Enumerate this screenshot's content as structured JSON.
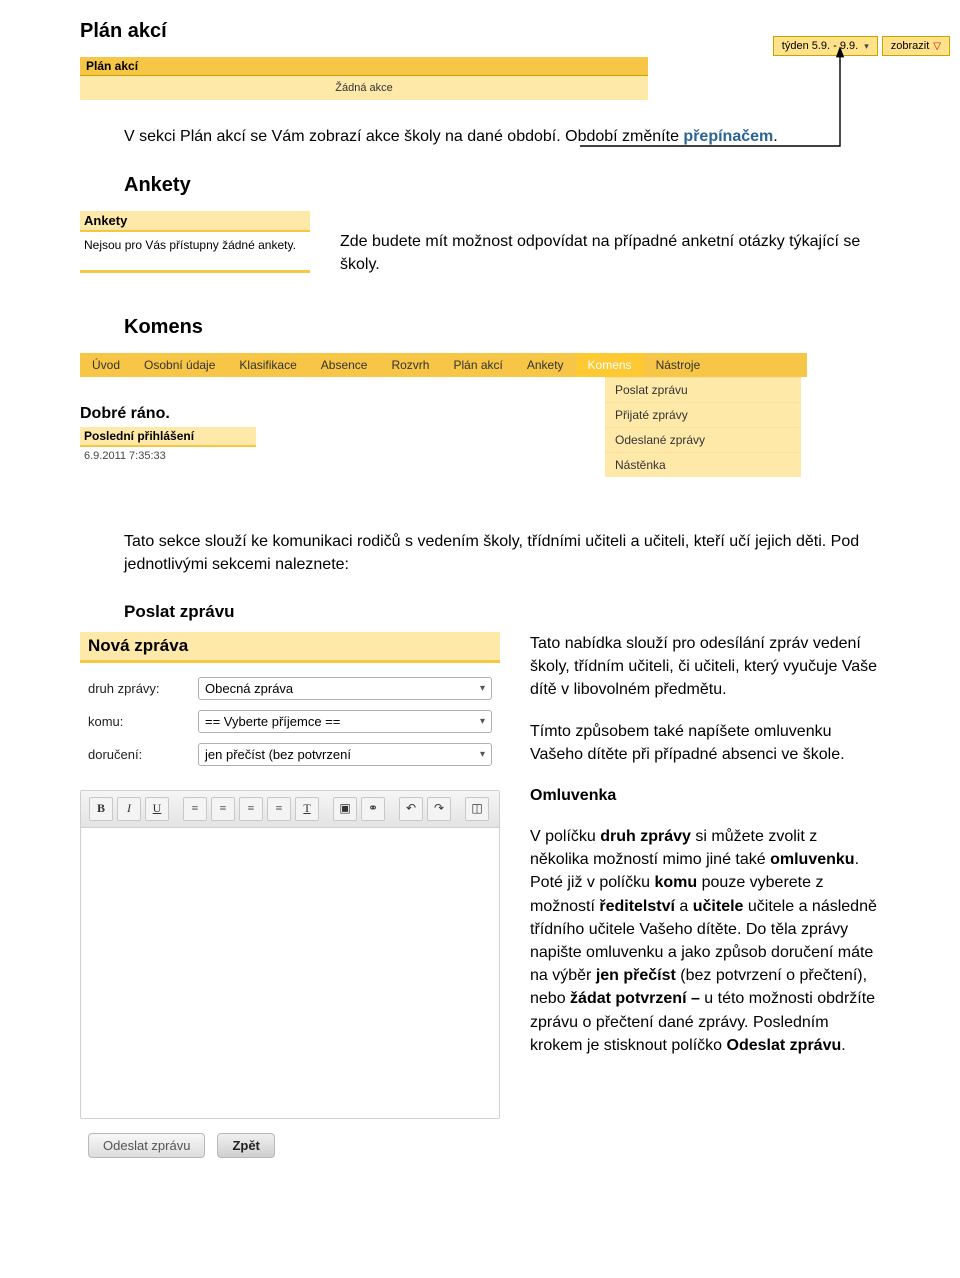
{
  "section_plan": "Plán akcí",
  "switcher": {
    "period": "týden 5.9. - 9.9.",
    "show": "zobrazit"
  },
  "plan_box": {
    "title": "Plán akcí",
    "empty": "Žádná akce"
  },
  "plan_desc": {
    "t1": "V sekci Plán akcí se Vám zobrazí akce školy na dané období. Období změníte ",
    "link": "přepínačem",
    "tail": "."
  },
  "section_ankety": "Ankety",
  "ankety_box": {
    "title": "Ankety",
    "body": "Nejsou pro Vás přístupny žádné ankety."
  },
  "ankety_desc": "Zde budete mít možnost odpovídat na případné anketní otázky týkající se školy.",
  "section_komens": "Komens",
  "nav": [
    "Úvod",
    "Osobní údaje",
    "Klasifikace",
    "Absence",
    "Rozvrh",
    "Plán akcí",
    "Ankety",
    "Komens",
    "Nástroje"
  ],
  "drop": [
    "Poslat zprávu",
    "Přijaté zprávy",
    "Odeslané zprávy",
    "Nástěnka"
  ],
  "greet": "Dobré ráno.",
  "login": {
    "head": "Poslední přihlášení",
    "val": "6.9.2011 7:35:33"
  },
  "komens_desc": "Tato sekce slouží ke komunikaci rodičů s vedením školy, třídními učiteli a učiteli, kteří učí jejich děti. Pod jednotlivými sekcemi naleznete:",
  "section_poslat": "Poslat zprávu",
  "msg": {
    "title": "Nová zpráva",
    "rows": {
      "druh": {
        "lbl": "druh zprávy:",
        "val": "Obecná zpráva"
      },
      "komu": {
        "lbl": "komu:",
        "val": "== Vyberte příjemce =="
      },
      "dor": {
        "lbl": "doručení:",
        "val": "jen přečíst (bez potvrzení"
      }
    },
    "send": "Odeslat zprávu",
    "back": "Zpět"
  },
  "poslat_text": {
    "p1": "Tato nabídka slouží pro odesílání zpráv vedení školy, třídním učiteli, či učiteli, který vyučuje Vaše dítě v libovolném předmětu.",
    "p2": "Tímto způsobem také napíšete omluvenku Vašeho dítěte při případné absenci ve škole.",
    "h": "Omluvenka",
    "p3a": "V políčku ",
    "p3b": "druh zprávy",
    "p3c": " si můžete zvolit z několika možností mimo jiné také ",
    "p3d": "omluvenku",
    "p3e": ". Poté již v políčku ",
    "p3f": "komu",
    "p3g": " pouze vyberete z možností ",
    "p3h": "ředitelství",
    "p3i": " a ",
    "p3j": "učitele",
    "p3k": " učitele a následně třídního učitele Vašeho dítěte. Do těla zprávy napište omluvenku a jako způsob doručení máte na výběr ",
    "p3l": "jen přečíst",
    "p3m": " (bez potvrzení o přečtení), nebo ",
    "p3n": "žádat potvrzení – ",
    "p3o": "u této možnosti obdržíte zprávu o přečtení dané zprávy. Posledním krokem je stisknout políčko ",
    "p3p": "Odeslat zprávu",
    "p3q": "."
  }
}
